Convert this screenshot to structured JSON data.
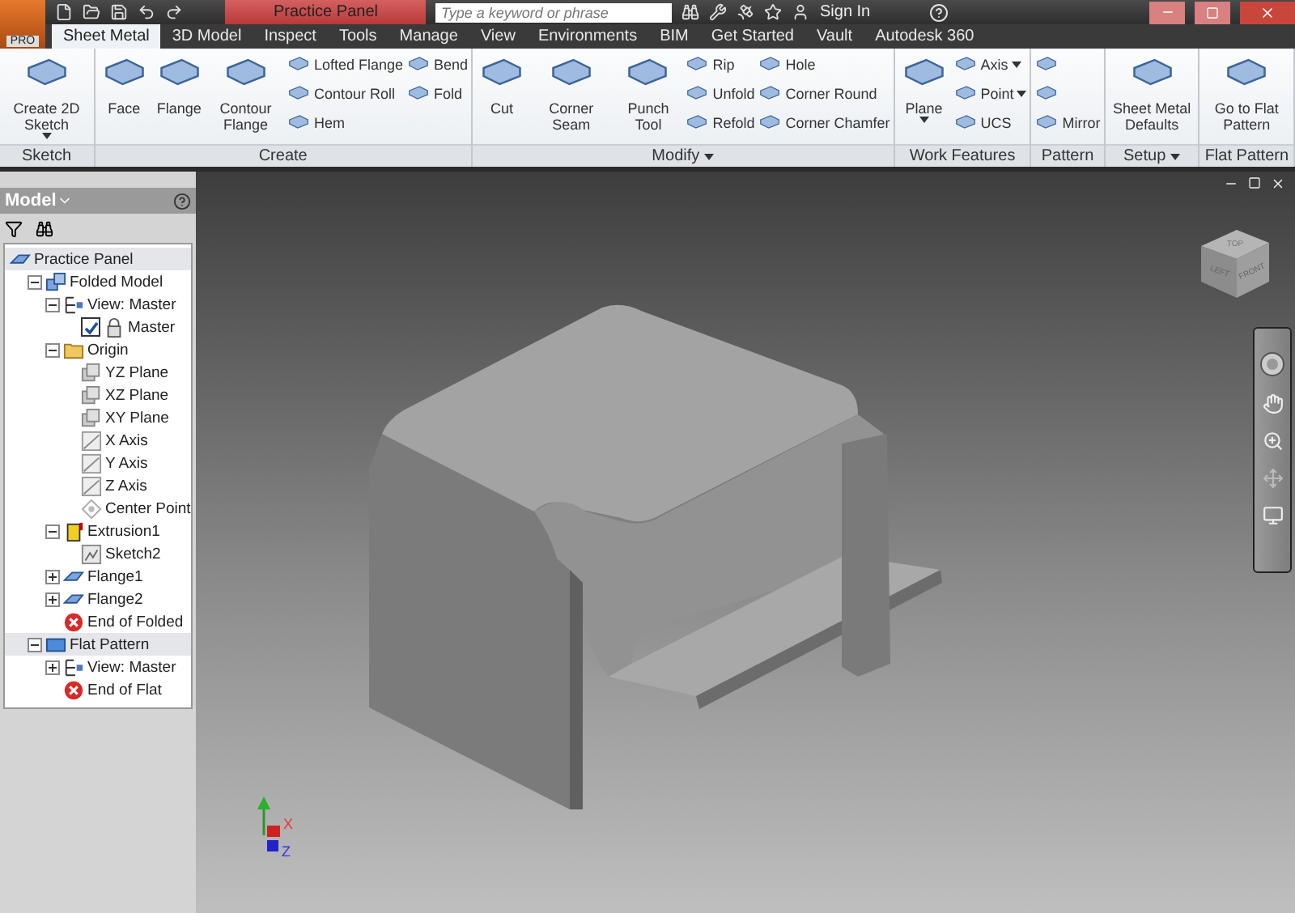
{
  "title_bar": {
    "app_badge": "PRO",
    "document_title": "Practice Panel",
    "search": {
      "placeholder": "Type a keyword or phrase"
    },
    "sign_in": "Sign In"
  },
  "tabs": [
    {
      "label": "Sheet Metal",
      "selected": true
    },
    {
      "label": "3D Model",
      "selected": false
    },
    {
      "label": "Inspect",
      "selected": false
    },
    {
      "label": "Tools",
      "selected": false
    },
    {
      "label": "Manage",
      "selected": false
    },
    {
      "label": "View",
      "selected": false
    },
    {
      "label": "Environments",
      "selected": false
    },
    {
      "label": "BIM",
      "selected": false
    },
    {
      "label": "Get Started",
      "selected": false
    },
    {
      "label": "Vault",
      "selected": false
    },
    {
      "label": "Autodesk 360",
      "selected": false
    }
  ],
  "ribbon": {
    "panels": [
      {
        "title": "Sketch",
        "items": [
          {
            "kind": "large",
            "label": "Create 2D Sketch",
            "dropdown": true
          }
        ]
      },
      {
        "title": "Create",
        "items": [
          {
            "kind": "large",
            "label": "Face"
          },
          {
            "kind": "large",
            "label": "Flange"
          },
          {
            "kind": "large",
            "label": "Contour Flange"
          },
          {
            "kind": "column",
            "tools": [
              {
                "label": "Lofted Flange"
              },
              {
                "label": "Contour Roll"
              },
              {
                "label": "Hem"
              }
            ]
          },
          {
            "kind": "column",
            "tools": [
              {
                "label": "Bend"
              },
              {
                "label": "Fold"
              }
            ]
          }
        ]
      },
      {
        "title": "Modify",
        "menu": true,
        "items": [
          {
            "kind": "large",
            "label": "Cut"
          },
          {
            "kind": "large",
            "label": "Corner Seam"
          },
          {
            "kind": "large",
            "label": "Punch Tool"
          },
          {
            "kind": "column",
            "tools": [
              {
                "label": "Rip"
              },
              {
                "label": "Unfold"
              },
              {
                "label": "Refold"
              }
            ]
          },
          {
            "kind": "column",
            "tools": [
              {
                "label": "Hole"
              },
              {
                "label": "Corner Round"
              },
              {
                "label": "Corner Chamfer"
              }
            ]
          }
        ]
      },
      {
        "title": "Work Features",
        "items": [
          {
            "kind": "large",
            "label": "Plane",
            "dropdown": true
          },
          {
            "kind": "column",
            "tools": [
              {
                "label": "Axis",
                "dropdown": true
              },
              {
                "label": "Point",
                "dropdown": true
              },
              {
                "label": "UCS"
              }
            ]
          }
        ]
      },
      {
        "title": "Pattern",
        "items": [
          {
            "kind": "column",
            "tools": [
              {
                "kind": "icon"
              },
              {
                "kind": "icon"
              },
              {
                "kind": "labeled",
                "label": "Mirror"
              }
            ]
          }
        ]
      },
      {
        "title": "Setup",
        "menu": true,
        "items": [
          {
            "kind": "large",
            "label": "Sheet Metal Defaults"
          }
        ]
      },
      {
        "title": "Flat Pattern",
        "items": [
          {
            "kind": "large",
            "label": "Go to Flat Pattern"
          }
        ]
      }
    ]
  },
  "browser": {
    "title": "Model",
    "tree": [
      {
        "label": "Practice Panel",
        "kind": "part",
        "selected": true,
        "children": [
          {
            "label": "Folded Model",
            "kind": "model",
            "selected": false,
            "expanded": true,
            "children": [
              {
                "label": "View: Master",
                "kind": "view",
                "selected": false,
                "expanded": true,
                "children": [
                  {
                    "label": "Master",
                    "kind": "lock",
                    "selected": false,
                    "checked": true
                  }
                ]
              },
              {
                "label": "Origin",
                "kind": "folder",
                "selected": false,
                "expanded": true,
                "children": [
                  {
                    "label": "YZ Plane",
                    "kind": "plane",
                    "selected": false
                  },
                  {
                    "label": "XZ Plane",
                    "kind": "plane",
                    "selected": false
                  },
                  {
                    "label": "XY Plane",
                    "kind": "plane",
                    "selected": false
                  },
                  {
                    "label": "X Axis",
                    "kind": "axis",
                    "selected": false
                  },
                  {
                    "label": "Y Axis",
                    "kind": "axis",
                    "selected": false
                  },
                  {
                    "label": "Z Axis",
                    "kind": "axis",
                    "selected": false
                  },
                  {
                    "label": "Center Point",
                    "kind": "point",
                    "selected": false
                  }
                ]
              },
              {
                "label": "Extrusion1",
                "kind": "extrusion",
                "selected": false,
                "expanded": true,
                "children": [
                  {
                    "label": "Sketch2",
                    "kind": "sketch",
                    "selected": false
                  }
                ]
              },
              {
                "label": "Flange1",
                "kind": "flange",
                "selected": false,
                "expanded": false
              },
              {
                "label": "Flange2",
                "kind": "flange",
                "selected": false,
                "expanded": false
              },
              {
                "label": "End of Folded",
                "kind": "end",
                "selected": false
              }
            ]
          },
          {
            "label": "Flat Pattern",
            "kind": "flat",
            "selected": true,
            "expanded": true,
            "children": [
              {
                "label": "View: Master",
                "kind": "view",
                "selected": false,
                "expanded": false
              },
              {
                "label": "End of Flat",
                "kind": "end",
                "selected": false
              }
            ]
          }
        ]
      }
    ]
  },
  "viewcube": {
    "faces": [
      "TOP",
      "LEFT",
      "FRONT"
    ]
  },
  "triad": {
    "x_label": "X",
    "z_label": "Z"
  }
}
